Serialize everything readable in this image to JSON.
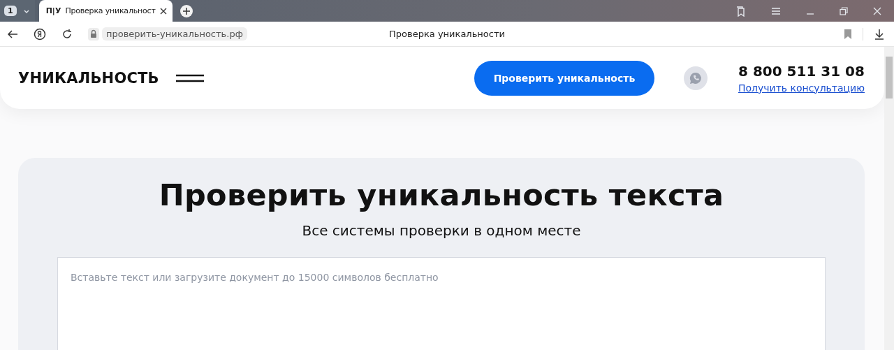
{
  "browser": {
    "tab_count": "1",
    "tab": {
      "favicon": "П|У",
      "title": "Проверка уникальност",
      "selected": true
    },
    "address": "проверить-уникальность.рф",
    "page_title": "Проверка уникальности"
  },
  "header": {
    "logo": "УНИКАЛЬНОСТЬ",
    "cta": "Проверить уникальность",
    "phone": "8 800 511 31 08",
    "consult_link": "Получить консультацию"
  },
  "hero": {
    "title": "Проверить уникальность текста",
    "subtitle": "Все системы проверки в одном месте",
    "text_input": {
      "placeholder": "Вставьте текст или загрузите документ до 15000 символов бесплатно"
    }
  }
}
